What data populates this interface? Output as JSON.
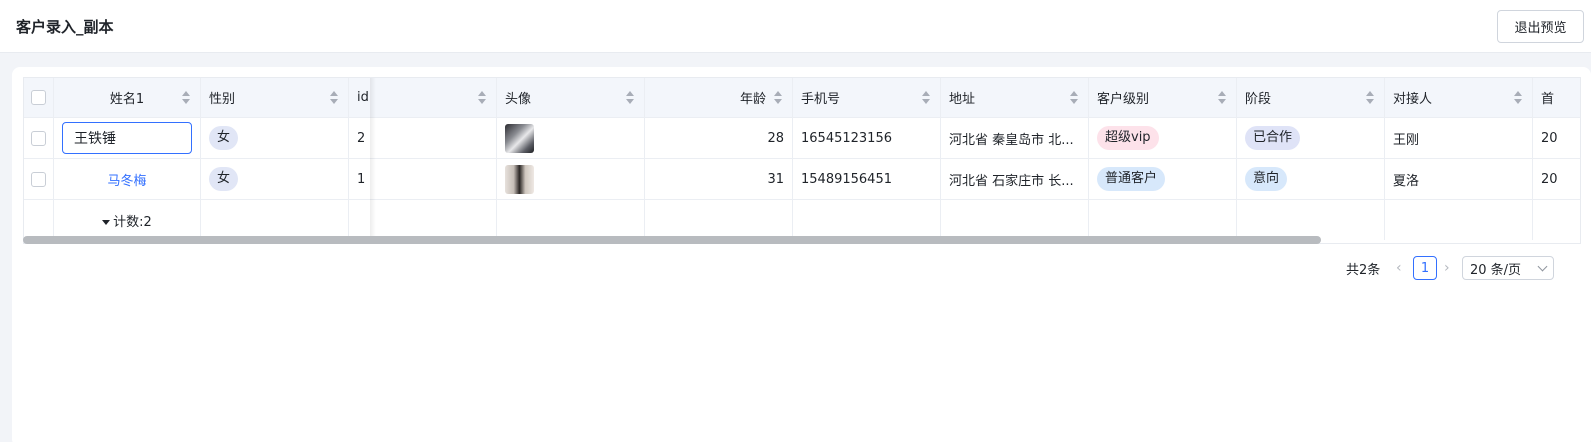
{
  "header": {
    "title": "客户录入_副本",
    "exit_label": "退出预览"
  },
  "table": {
    "columns": [
      "姓名1",
      "性别",
      "id",
      "头像",
      "年龄",
      "手机号",
      "地址",
      "客户级别",
      "阶段",
      "对接人",
      "首"
    ],
    "rows": [
      {
        "name": "王铁锤",
        "gender": "女",
        "id": "2",
        "avatar": "avatar-image",
        "age": "28",
        "phone": "16545123156",
        "address": "河北省 秦皇岛市 北...",
        "level": "超级vip",
        "stage": "已合作",
        "contact": "王刚",
        "first": "20"
      },
      {
        "name": "马冬梅",
        "gender": "女",
        "id": "1",
        "avatar": "avatar-image",
        "age": "31",
        "phone": "15489156451",
        "address": "河北省 石家庄市 长...",
        "level": "普通客户",
        "stage": "意向",
        "contact": "夏洛",
        "first": "20"
      }
    ],
    "footer_count": "计数:2"
  },
  "pagination": {
    "total": "共2条",
    "current_page": "1",
    "page_size": "20 条/页"
  },
  "colors": {
    "accent": "#3370ff",
    "tag_pink": "#fde2ea",
    "tag_blue": "#d7e8fb",
    "tag_lavender": "#dfe3f7"
  }
}
